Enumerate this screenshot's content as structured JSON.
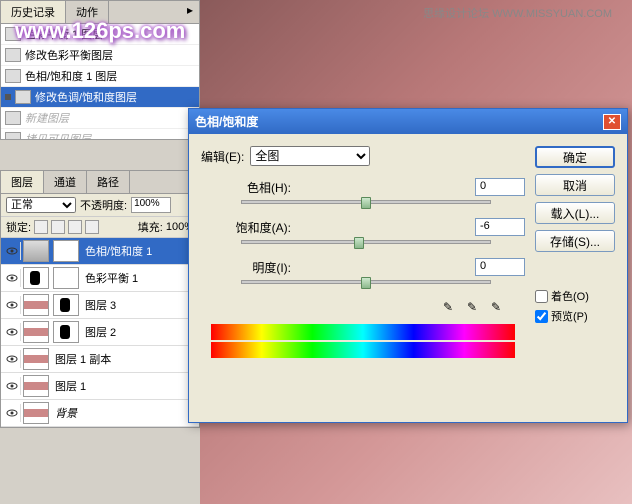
{
  "watermark": "思缘设计论坛  WWW.MISSYUAN.COM",
  "url_overlay": "www.126ps.com",
  "history": {
    "tab_history": "历史记录",
    "tab_actions": "动作",
    "items": [
      {
        "label": "色彩平衡 1 图层",
        "sel": false
      },
      {
        "label": "修改色彩平衡图层",
        "sel": false
      },
      {
        "label": "色相/饱和度 1 图层",
        "sel": false
      },
      {
        "label": "修改色调/饱和度图层",
        "sel": true
      },
      {
        "label": "新建图层",
        "sel": false,
        "italic": true
      },
      {
        "label": "拷贝可见图层",
        "sel": false,
        "italic": true
      }
    ]
  },
  "layers": {
    "tab_layers": "图层",
    "tab_channels": "通道",
    "tab_paths": "路径",
    "blend_mode": "正常",
    "opacity_label": "不透明度:",
    "opacity_value": "100%",
    "lock_label": "锁定:",
    "fill_label": "填充:",
    "fill_value": "100%",
    "items": [
      {
        "name": "色相/饱和度 1",
        "sel": true
      },
      {
        "name": "色彩平衡 1",
        "sel": false
      },
      {
        "name": "图层 3",
        "sel": false
      },
      {
        "name": "图层 2",
        "sel": false
      },
      {
        "name": "图层 1 副本",
        "sel": false
      },
      {
        "name": "图层 1",
        "sel": false
      },
      {
        "name": "背景",
        "sel": false
      }
    ]
  },
  "dialog": {
    "title": "色相/饱和度",
    "edit_label": "编辑(E):",
    "edit_value": "全图",
    "hue_label": "色相(H):",
    "hue_value": "0",
    "sat_label": "饱和度(A):",
    "sat_value": "-6",
    "light_label": "明度(I):",
    "light_value": "0",
    "ok": "确定",
    "cancel": "取消",
    "load": "载入(L)...",
    "save": "存储(S)...",
    "colorize": "着色(O)",
    "preview": "预览(P)"
  },
  "chart_data": {
    "type": "table",
    "title": "色相/饱和度",
    "series": [
      {
        "name": "色相",
        "values": [
          0
        ]
      },
      {
        "name": "饱和度",
        "values": [
          -6
        ]
      },
      {
        "name": "明度",
        "values": [
          0
        ]
      }
    ],
    "range": [
      -100,
      100
    ]
  }
}
